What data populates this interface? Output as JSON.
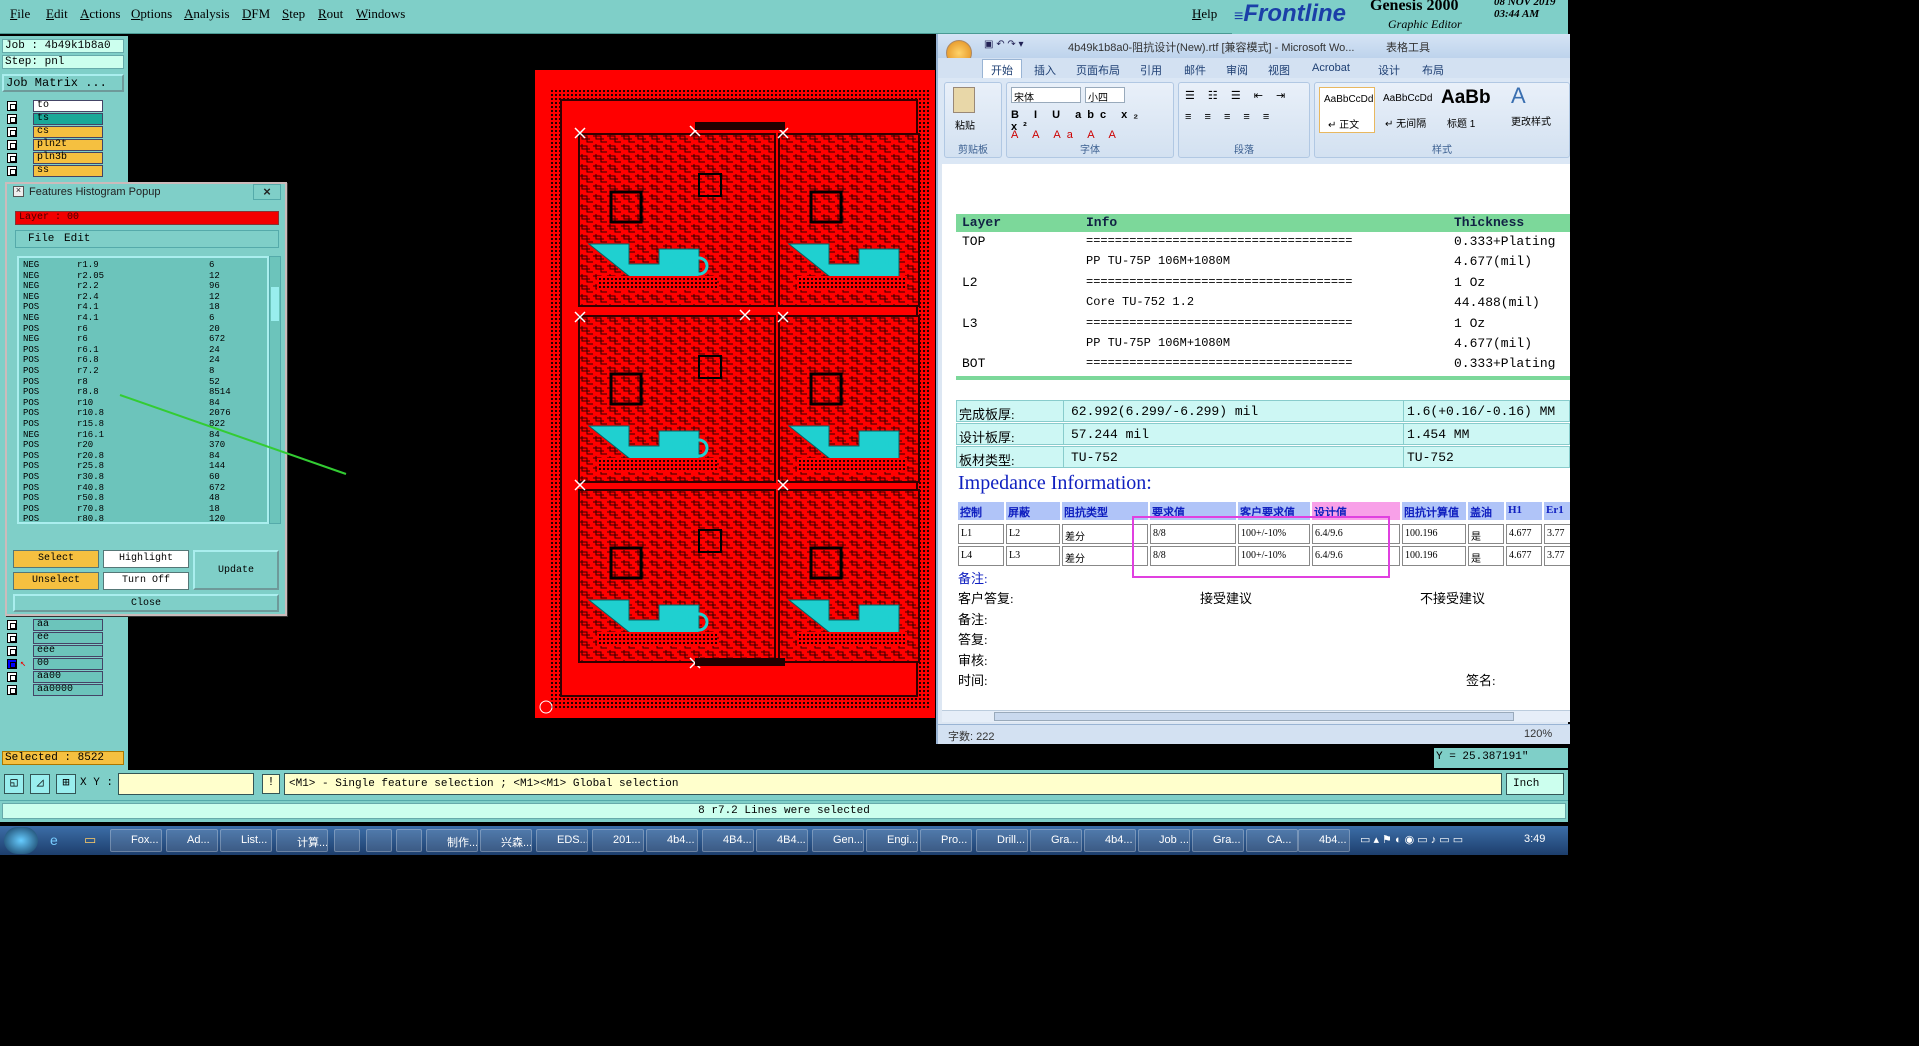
{
  "menu": {
    "items": [
      "File",
      "Edit",
      "Actions",
      "Options",
      "Analysis",
      "DFM",
      "Step",
      "Rout",
      "Windows"
    ],
    "help": "Help"
  },
  "brand": {
    "logo": "Frontline",
    "product": "Genesis 2000",
    "subtitle": "Graphic Editor",
    "date": "08 NOV 2019",
    "time": "03:44 AM"
  },
  "job": {
    "job": "Job : 4b49k1b8a0",
    "step": "Step: pnl",
    "matrix": "Job Matrix ..."
  },
  "layers_top": [
    "to",
    "ts",
    "cs",
    "pln2t",
    "pln3b",
    "ss"
  ],
  "layers_bottom": [
    "aa",
    "ee",
    "eee",
    "00",
    "aa00",
    "aa0000"
  ],
  "selected": "Selected : 8522",
  "popup": {
    "title": "Features Histogram Popup",
    "layer": "Layer : 00",
    "menu": [
      "File",
      "Edit"
    ],
    "rows": [
      [
        "NEG",
        "r1.9",
        "6"
      ],
      [
        "NEG",
        "r2.05",
        "12"
      ],
      [
        "NEG",
        "r2.2",
        "96"
      ],
      [
        "NEG",
        "r2.4",
        "12"
      ],
      [
        "POS",
        "r4.1",
        "18"
      ],
      [
        "NEG",
        "r4.1",
        "6"
      ],
      [
        "POS",
        "r6",
        "20"
      ],
      [
        "NEG",
        "r6",
        "672"
      ],
      [
        "POS",
        "r6.1",
        "24"
      ],
      [
        "POS",
        "r6.8",
        "24"
      ],
      [
        "POS",
        "r7.2",
        "8"
      ],
      [
        "POS",
        "r8",
        "52"
      ],
      [
        "POS",
        "r8.8",
        "8514"
      ],
      [
        "POS",
        "r10",
        "84"
      ],
      [
        "POS",
        "r10.8",
        "2076"
      ],
      [
        "POS",
        "r15.8",
        "822"
      ],
      [
        "NEG",
        "r16.1",
        "84"
      ],
      [
        "POS",
        "r20",
        "370"
      ],
      [
        "POS",
        "r20.8",
        "84"
      ],
      [
        "POS",
        "r25.8",
        "144"
      ],
      [
        "POS",
        "r30.8",
        "60"
      ],
      [
        "POS",
        "r40.8",
        "672"
      ],
      [
        "POS",
        "r50.8",
        "48"
      ],
      [
        "POS",
        "r70.8",
        "18"
      ],
      [
        "POS",
        "r80.8",
        "120"
      ]
    ],
    "buttons": {
      "select": "Select",
      "highlight": "Highlight",
      "update": "Update",
      "unselect": "Unselect",
      "turnoff": "Turn Off",
      "close": "Close"
    }
  },
  "word": {
    "title": "4b49k1b8a0-阻抗设计(New).rtf [兼容模式] - Microsoft Wo...",
    "tools": "表格工具",
    "tabs": [
      "开始",
      "插入",
      "页面布局",
      "引用",
      "邮件",
      "审阅",
      "视图",
      "Acrobat",
      "设计",
      "布局"
    ],
    "font": "宋体",
    "size": "小四",
    "paste": "粘贴",
    "groups": [
      "剪贴板",
      "字体",
      "段落",
      "样式"
    ],
    "styles": [
      {
        "sample": "AaBbCcDd",
        "name": "↵ 正文"
      },
      {
        "sample": "AaBbCcDd",
        "name": "↵ 无间隔"
      },
      {
        "sample": "AaBb",
        "name": "标题 1"
      }
    ],
    "change_style": "更改样式",
    "wordcount": "字数: 222",
    "zoom": "120%"
  },
  "stack": {
    "headers": [
      "Layer",
      "Info",
      "Thickness"
    ],
    "rows": [
      [
        "TOP",
        "=====================================",
        "0.333+Plating"
      ],
      [
        "",
        "PP    TU-75P    106M+1080M",
        "4.677(mil)"
      ],
      [
        "L2",
        "=====================================",
        "1 Oz"
      ],
      [
        "",
        "Core    TU-752    1.2",
        "44.488(mil)"
      ],
      [
        "L3",
        "=====================================",
        "1 Oz"
      ],
      [
        "",
        "PP    TU-75P    106M+1080M",
        "4.677(mil)"
      ],
      [
        "BOT",
        "=====================================",
        "0.333+Plating"
      ]
    ]
  },
  "thick": [
    [
      "完成板厚:",
      "62.992(6.299/-6.299) mil",
      "1.6(+0.16/-0.16) MM"
    ],
    [
      "设计板厚:",
      "57.244 mil",
      "1.454 MM"
    ],
    [
      "板材类型:",
      "TU-752",
      "TU-752"
    ]
  ],
  "imp": {
    "heading": "Impedance Information:",
    "headers": [
      "控制",
      "屏蔽",
      "阻抗类型",
      "要求值",
      "客户要求值",
      "设计值",
      "阻抗计算值",
      "盖油",
      "H1",
      "Er1"
    ],
    "rows": [
      [
        "L1",
        "L2",
        "差分",
        "8/8",
        "100+/-10%",
        "6.4/9.6",
        "100.196",
        "是",
        "4.677",
        "3.77"
      ],
      [
        "L4",
        "L3",
        "差分",
        "8/8",
        "100+/-10%",
        "6.4/9.6",
        "100.196",
        "是",
        "4.677",
        "3.77"
      ]
    ]
  },
  "notes": {
    "note": "备注:",
    "reply": "客户答复:",
    "accept": "接受建议",
    "reject": "不接受建议",
    "note2": "备注:",
    "answer": "答复:",
    "review": "审核:",
    "time": "时间:",
    "sign": "签名:"
  },
  "coords": {
    "y": "Y = 25.387191\""
  },
  "bottom": {
    "xy": "X Y :",
    "hint": "<M1> - Single feature selection ; <M1><M1> Global selection",
    "unit": "Inch"
  },
  "status": "8 r7.2 Lines were selected",
  "taskbar": {
    "items": [
      "Fox...",
      "Ad...",
      "List...",
      "计算...",
      "",
      "",
      "",
      "制作...",
      "兴森...",
      "EDS...",
      "201...",
      "4b4...",
      "4B4...",
      "4B4...",
      "Gen...",
      "Engi...",
      "Pro...",
      "Drill...",
      "Gra...",
      "4b4...",
      "Job ...",
      "Gra...",
      "CA...",
      "4b4..."
    ],
    "clock": "3:49"
  }
}
